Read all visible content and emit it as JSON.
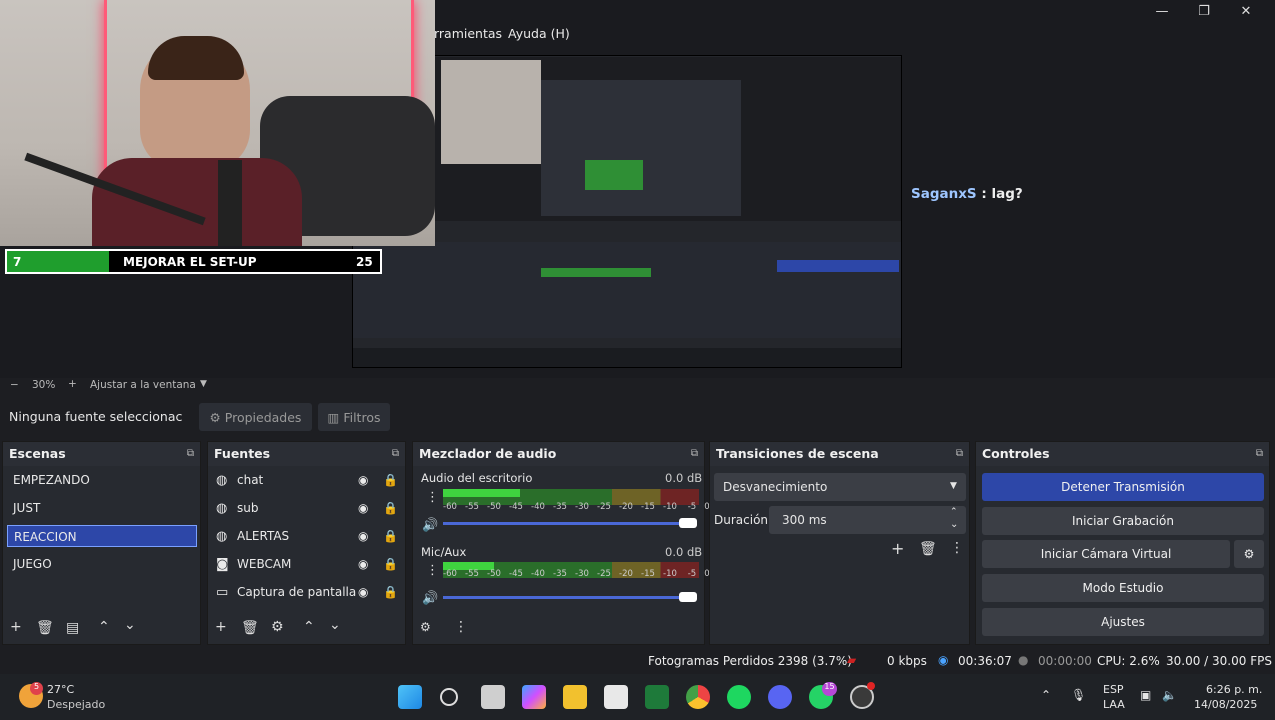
{
  "menu": {
    "tools": "rramientas",
    "help": "Ayuda (H)"
  },
  "window_controls": {
    "minimize": "—",
    "maximize": "❐",
    "close": "✕"
  },
  "chat": {
    "user": "SaganxS",
    "message": " : lag?"
  },
  "overlay": {
    "left_number": "7",
    "title": "MEJORAR EL SET-UP",
    "right_number": "25"
  },
  "zoom": {
    "minus": "−",
    "value": "30%",
    "plus": "+",
    "fit_label": "Ajustar a la ventana"
  },
  "source_bar": {
    "no_source": "Ninguna fuente seleccionac",
    "properties": "Propiedades",
    "filters": "Filtros"
  },
  "scenes": {
    "title": "Escenas",
    "items": [
      "EMPEZANDO",
      "JUST",
      "REACCION",
      "JUEGO"
    ],
    "selected": "REACCION"
  },
  "sources": {
    "title": "Fuentes",
    "items": [
      {
        "label": "chat",
        "icon": "globe-icon"
      },
      {
        "label": "sub",
        "icon": "globe-icon"
      },
      {
        "label": "ALERTAS",
        "icon": "globe-icon"
      },
      {
        "label": "WEBCAM",
        "icon": "camera-icon"
      },
      {
        "label": "Captura de pantalla",
        "icon": "monitor-icon"
      }
    ]
  },
  "mixer": {
    "title": "Mezclador de audio",
    "channels": [
      {
        "name": "Audio del escritorio",
        "db": "0.0 dB",
        "level": 0.3
      },
      {
        "name": "Mic/Aux",
        "db": "0.0 dB",
        "level": 0.2
      }
    ],
    "ticks": [
      "-60",
      "-55",
      "-50",
      "-45",
      "-40",
      "-35",
      "-30",
      "-25",
      "-20",
      "-15",
      "-10",
      "-5",
      "0"
    ]
  },
  "transitions": {
    "title": "Transiciones de escena",
    "selected": "Desvanecimiento",
    "duration_label": "Duración",
    "duration_value": "300 ms"
  },
  "controls": {
    "title": "Controles",
    "stop_stream": "Detener Transmisión",
    "start_recording": "Iniciar Grabación",
    "virtual_cam": "Iniciar Cámara Virtual",
    "studio_mode": "Modo Estudio",
    "settings": "Ajustes"
  },
  "status": {
    "dropped": "Fotogramas Perdidos 2398 (3.7%)",
    "kbps": "0 kbps",
    "stream_time": "00:36:07",
    "rec_time": "00:00:00",
    "cpu": "CPU: 2.6%",
    "fps": "30.00 / 30.00 FPS"
  },
  "taskbar": {
    "weather_temp": "27°C",
    "weather_desc": "Despejado",
    "weather_badge": "5",
    "whatsapp_badge": "15",
    "lang": "ESP",
    "layout": "LAA",
    "time": "6:26 p. m.",
    "date": "14/08/2025"
  },
  "colors": {
    "accent": "#2d47a8",
    "meter_green": "#3fd43f",
    "meter_yellow": "#b8a72c",
    "meter_red": "#b62b2b"
  }
}
